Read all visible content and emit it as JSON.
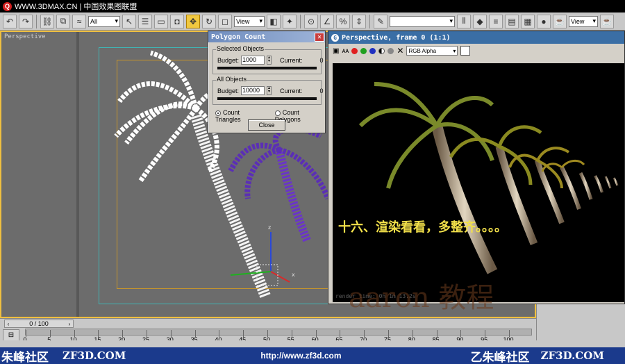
{
  "site_header": {
    "logo_icon": "site-logo-icon",
    "text": "WWW.3DMAX.CN | 中国效果图联盟"
  },
  "toolbar": {
    "selection_filter": "All",
    "ref_coord": "View",
    "named_selection": "",
    "view_select": "View"
  },
  "viewport": {
    "label": "Perspective"
  },
  "polygon_dialog": {
    "title": "Polygon Count",
    "selected": {
      "group_label": "Selected Objects",
      "budget_label": "Budget:",
      "budget_value": "1000",
      "current_label": "Current:",
      "current_value": "0",
      "progress": 0.0
    },
    "all": {
      "group_label": "All Objects",
      "budget_label": "Budget:",
      "budget_value": "10000",
      "current_label": "Current:",
      "current_value": "0",
      "progress": 0.0
    },
    "count_triangles": "Count Triangles",
    "count_polygons": "Count Polygons",
    "selected_mode": "Count Triangles",
    "close_label": "Close"
  },
  "render_window": {
    "title": "Perspective, frame 0 (1:1)",
    "channel": "RGB Alpha",
    "caption": "十六、渲染看看，多整齐。。。。",
    "render_time": "render time: 0h 1m 13.2s"
  },
  "watermark": "aaron  教程",
  "time_slider": {
    "label": "0 / 100",
    "ticks": [
      "0",
      "5",
      "10",
      "15",
      "20",
      "25",
      "30",
      "35",
      "40",
      "45",
      "50",
      "55",
      "60",
      "65",
      "70",
      "75",
      "80",
      "85",
      "90",
      "95",
      "100"
    ]
  },
  "footer": {
    "left_cn": "朱峰社区",
    "left_site": "ZF3D.COM",
    "url": "http://www.zf3d.com",
    "right_cn": "乙朱峰社区",
    "right_site": "ZF3D.COM"
  },
  "colors": {
    "viewport_border": "#f0c040",
    "caption": "#f2e04a",
    "footer_bg": "#1b3a8c",
    "progress": "#1aa31a"
  }
}
